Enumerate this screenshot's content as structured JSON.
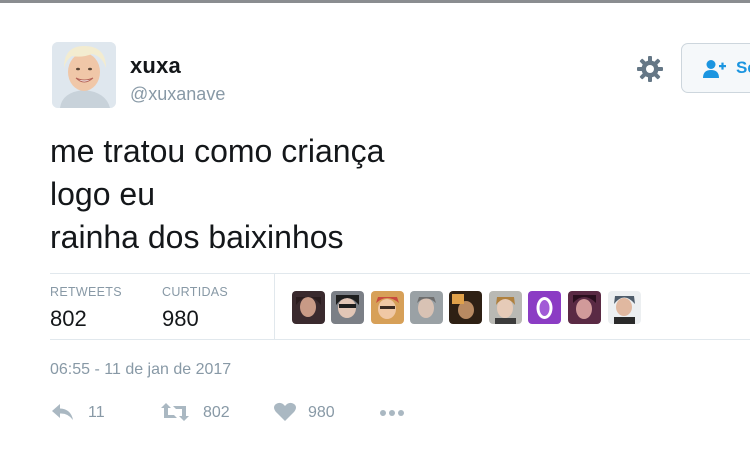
{
  "tweet": {
    "author": {
      "display_name": "xuxa",
      "handle": "@xuxanave",
      "avatar_icon": "profile-photo"
    },
    "text_lines": [
      "me tratou como criança",
      "logo eu",
      "rainha dos baixinhos"
    ],
    "stats": {
      "retweets_label": "RETWEETS",
      "retweets_value": "802",
      "likes_label": "CURTIDAS",
      "likes_value": "980"
    },
    "timestamp": "06:55 - 11 de jan de 2017",
    "actions": {
      "reply_count": "11",
      "retweet_count": "802",
      "like_count": "980",
      "more_icon": "ellipsis-icon"
    }
  },
  "header": {
    "settings_icon": "gear-icon",
    "follow_label": "Se",
    "follow_icon": "add-user-icon"
  },
  "likers": {
    "count_shown": 9,
    "icon": "user-avatar"
  },
  "colors": {
    "text": "#14171a",
    "muted": "#8899a6",
    "accent": "#1b95e0",
    "divider": "#e1e8ed"
  }
}
